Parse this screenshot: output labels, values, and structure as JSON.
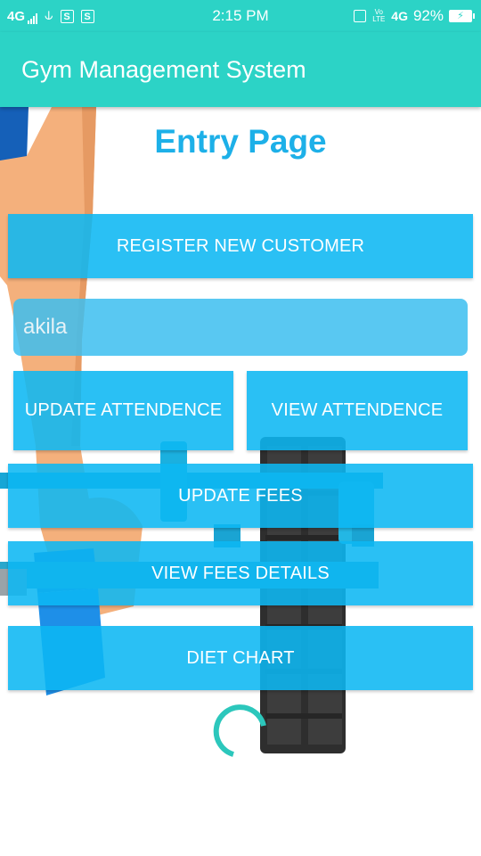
{
  "status_bar": {
    "network_left": "4G",
    "time": "2:15 PM",
    "lte": "Vo LTE",
    "network_right": "4G",
    "battery_percent": "92%",
    "icons_left": [
      "signal-bars-icon",
      "usb-icon",
      "s-app-icon",
      "s-app-icon"
    ],
    "icons_right": [
      "vibrate-icon",
      "battery-charging-icon"
    ]
  },
  "app_bar": {
    "title": "Gym Management System"
  },
  "main": {
    "heading": "Entry Page",
    "register_button": "REGISTER NEW CUSTOMER",
    "name_input_value": "akila",
    "update_attendance_button": "UPDATE ATTENDENCE",
    "view_attendance_button": "VIEW ATTENDENCE",
    "update_fees_button": "UPDATE FEES",
    "view_fees_button": "VIEW FEES DETAILS",
    "diet_chart_button": "DIET CHART"
  },
  "colors": {
    "primary": "#2cd3c6",
    "button": "#0db7f3",
    "heading": "#1db0e8"
  }
}
